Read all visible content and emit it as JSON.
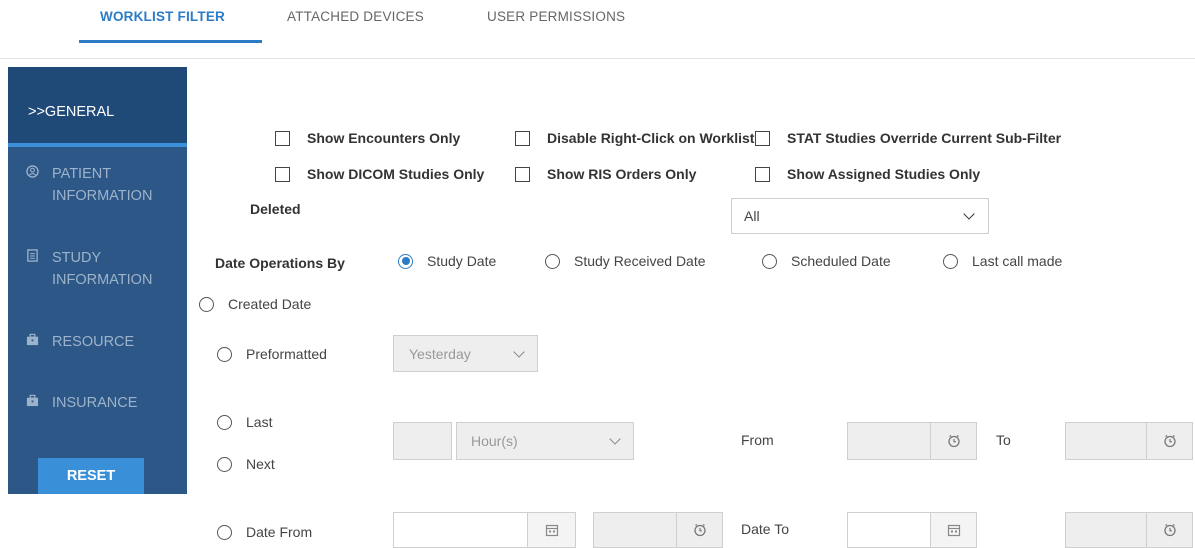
{
  "tabs": [
    {
      "label": "WORKLIST FILTER",
      "active": true
    },
    {
      "label": "ATTACHED DEVICES",
      "active": false
    },
    {
      "label": "USER PERMISSIONS",
      "active": false
    }
  ],
  "sidebar": {
    "items": [
      {
        "label": ">>GENERAL",
        "icon": "none",
        "active": true
      },
      {
        "label": "PATIENT\nINFORMATION",
        "icon": "user-circle-icon",
        "active": false
      },
      {
        "label": "STUDY\nINFORMATION",
        "icon": "document-icon",
        "active": false
      },
      {
        "label": "RESOURCE",
        "icon": "briefcase-icon",
        "active": false
      },
      {
        "label": "INSURANCE",
        "icon": "briefcase-icon",
        "active": false
      }
    ],
    "reset_label": "RESET"
  },
  "checkboxes": {
    "show_encounters_only": "Show Encounters Only",
    "disable_right_click": "Disable Right-Click on Worklist",
    "stat_studies_override": "STAT Studies Override Current Sub-Filter",
    "show_dicom_studies_only": "Show DICOM Studies Only",
    "show_ris_orders_only": "Show RIS Orders Only",
    "show_assigned_studies_only": "Show Assigned Studies Only"
  },
  "deleted": {
    "label": "Deleted",
    "selected": "All"
  },
  "date_ops": {
    "label": "Date Operations By",
    "options": {
      "study_date": "Study Date",
      "study_received_date": "Study Received Date",
      "scheduled_date": "Scheduled Date",
      "last_call_made": "Last call made",
      "created_date": "Created Date"
    },
    "selected": "Study Date"
  },
  "range": {
    "preformatted_label": "Preformatted",
    "preformatted_value": "Yesterday",
    "last_label": "Last",
    "next_label": "Next",
    "unit_value": "Hour(s)",
    "from_label": "From",
    "to_label": "To",
    "date_from_label": "Date From",
    "date_to_label": "Date To"
  },
  "colors": {
    "accent": "#2b7bc7",
    "sidebar_bg": "#2c5786",
    "sidebar_active_bg": "#1f4a78",
    "reset_bg": "#3a90d8"
  }
}
